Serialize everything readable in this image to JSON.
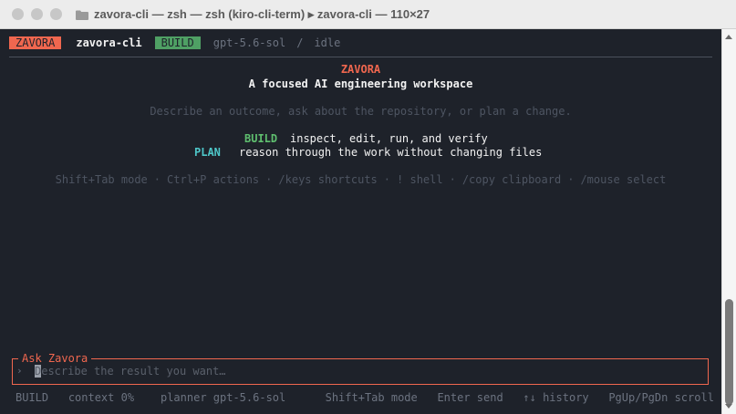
{
  "window": {
    "title": "zavora-cli — zsh — zsh (kiro-cli-term) ▸ zavora-cli — 110×27",
    "folder_icon": "folder-icon"
  },
  "header": {
    "brand_badge": "ZAVORA",
    "app_name": "zavora-cli",
    "mode_badge": "BUILD",
    "model": "gpt-5.6-sol",
    "separator": "/",
    "state": "idle"
  },
  "welcome": {
    "brand": "ZAVORA",
    "tagline": "A focused AI engineering workspace",
    "hint": "Describe an outcome, ask about the repository, or plan a change.",
    "modes": [
      {
        "name": "BUILD",
        "description": "inspect, edit, run, and verify"
      },
      {
        "name": "PLAN",
        "description": "reason through the work without changing files"
      }
    ],
    "shortcuts": [
      "Shift+Tab mode",
      "Ctrl+P actions",
      "/keys shortcuts",
      "! shell",
      "/copy clipboard",
      "/mouse select"
    ],
    "shortcut_sep": "·"
  },
  "input": {
    "legend": "Ask Zavora",
    "prompt_symbol": "›",
    "value": "",
    "placeholder": "Describe the result you want…"
  },
  "status_bar": {
    "mode": "BUILD",
    "context": "context 0%",
    "planner": "planner gpt-5.6-sol",
    "mode_hint": "Shift+Tab mode",
    "send_hint": "Enter send",
    "history_hint": "↑↓ history",
    "scroll_hint": "PgUp/PgDn scroll"
  },
  "colors": {
    "accent": "#f0674f",
    "build": "#4fa064",
    "plan": "#4ec7c9",
    "background": "#1e222a"
  }
}
